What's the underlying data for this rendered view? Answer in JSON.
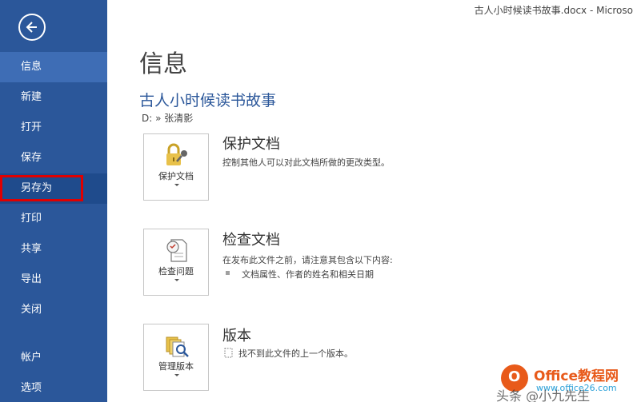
{
  "window": {
    "title": "古人小时候读书故事.docx - Microso"
  },
  "sidebar": {
    "back_icon": "back-arrow-icon",
    "items": [
      {
        "label": "信息"
      },
      {
        "label": "新建"
      },
      {
        "label": "打开"
      },
      {
        "label": "保存"
      },
      {
        "label": "另存为"
      },
      {
        "label": "打印"
      },
      {
        "label": "共享"
      },
      {
        "label": "导出"
      },
      {
        "label": "关闭"
      },
      {
        "label": "帐户"
      },
      {
        "label": "选项"
      }
    ],
    "accent": "#2b579a",
    "highlight": "#e00000"
  },
  "main": {
    "page_title": "信息",
    "doc_title": "古人小时候读书故事",
    "doc_path": "D: » 张清影",
    "sections": [
      {
        "button_label": "保护文档",
        "icon": "lock-key-icon",
        "title": "保护文档",
        "desc": "控制其他人可以对此文档所做的更改类型。"
      },
      {
        "button_label": "检查问题",
        "icon": "inspect-document-icon",
        "title": "检查文档",
        "desc": "在发布此文件之前，请注意其包含以下内容:",
        "bullets": [
          "文档属性、作者的姓名和相关日期"
        ]
      },
      {
        "button_label": "管理版本",
        "icon": "manage-versions-icon",
        "title": "版本",
        "desc": "找不到此文件的上一个版本。"
      }
    ]
  },
  "watermark": {
    "logo_letter": "O",
    "brand": "Office教程网",
    "url": "www.office26.com",
    "overlay": "头条 @小九先生"
  }
}
